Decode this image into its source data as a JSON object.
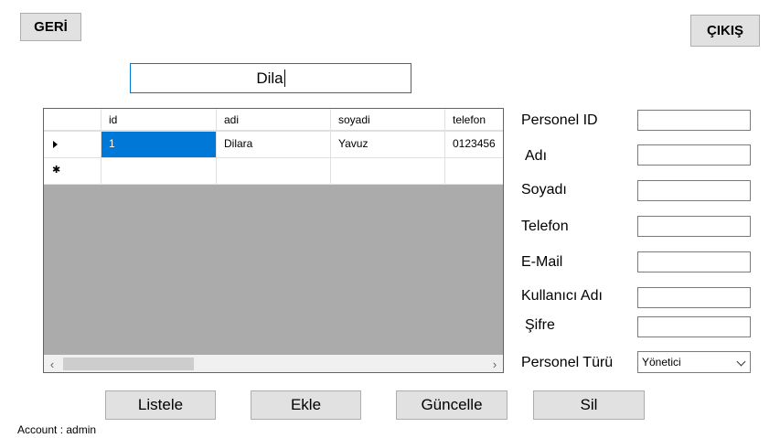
{
  "header": {
    "back_label": "GERİ",
    "exit_label": "ÇIKIŞ"
  },
  "search": {
    "value": "Dila"
  },
  "grid": {
    "columns": [
      "id",
      "adi",
      "soyadi",
      "telefon"
    ],
    "rows": [
      [
        "1",
        "Dilara",
        "Yavuz",
        "0123456"
      ]
    ]
  },
  "form": {
    "labels": {
      "id": "Personel ID",
      "name": "Adı",
      "surname": "Soyadı",
      "phone": "Telefon",
      "email": "E-Mail",
      "username": "Kullanıcı Adı",
      "password": "Şifre",
      "type": "Personel Türü"
    },
    "values": {
      "id": "",
      "name": "",
      "surname": "",
      "phone": "",
      "email": "",
      "username": "",
      "password": ""
    },
    "type_selected": "Yönetici"
  },
  "actions": {
    "list": "Listele",
    "add": "Ekle",
    "update": "Güncelle",
    "delete": "Sil"
  },
  "status": {
    "account": "Account : admin"
  }
}
